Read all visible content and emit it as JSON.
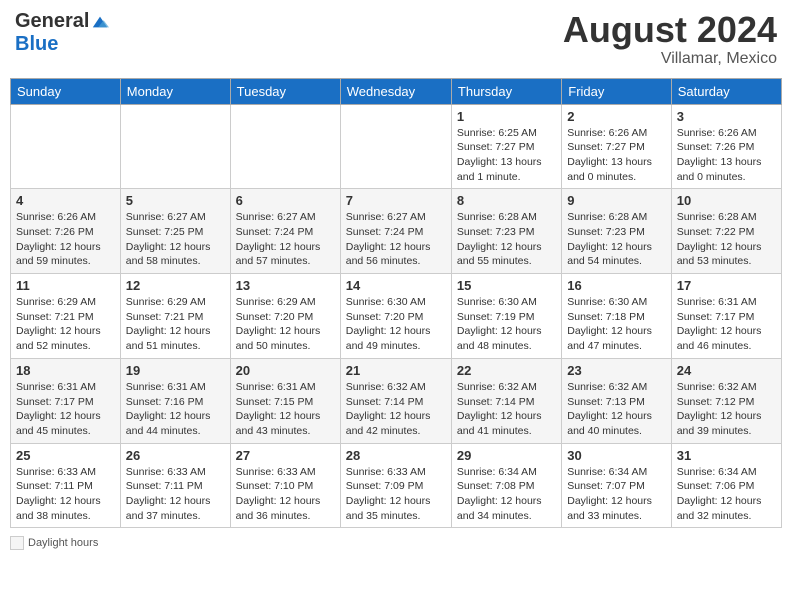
{
  "header": {
    "logo_general": "General",
    "logo_blue": "Blue",
    "month_title": "August 2024",
    "location": "Villamar, Mexico"
  },
  "days_of_week": [
    "Sunday",
    "Monday",
    "Tuesday",
    "Wednesday",
    "Thursday",
    "Friday",
    "Saturday"
  ],
  "weeks": [
    [
      {
        "day": "",
        "info": ""
      },
      {
        "day": "",
        "info": ""
      },
      {
        "day": "",
        "info": ""
      },
      {
        "day": "",
        "info": ""
      },
      {
        "day": "1",
        "info": "Sunrise: 6:25 AM\nSunset: 7:27 PM\nDaylight: 13 hours\nand 1 minute."
      },
      {
        "day": "2",
        "info": "Sunrise: 6:26 AM\nSunset: 7:27 PM\nDaylight: 13 hours\nand 0 minutes."
      },
      {
        "day": "3",
        "info": "Sunrise: 6:26 AM\nSunset: 7:26 PM\nDaylight: 13 hours\nand 0 minutes."
      }
    ],
    [
      {
        "day": "4",
        "info": "Sunrise: 6:26 AM\nSunset: 7:26 PM\nDaylight: 12 hours\nand 59 minutes."
      },
      {
        "day": "5",
        "info": "Sunrise: 6:27 AM\nSunset: 7:25 PM\nDaylight: 12 hours\nand 58 minutes."
      },
      {
        "day": "6",
        "info": "Sunrise: 6:27 AM\nSunset: 7:24 PM\nDaylight: 12 hours\nand 57 minutes."
      },
      {
        "day": "7",
        "info": "Sunrise: 6:27 AM\nSunset: 7:24 PM\nDaylight: 12 hours\nand 56 minutes."
      },
      {
        "day": "8",
        "info": "Sunrise: 6:28 AM\nSunset: 7:23 PM\nDaylight: 12 hours\nand 55 minutes."
      },
      {
        "day": "9",
        "info": "Sunrise: 6:28 AM\nSunset: 7:23 PM\nDaylight: 12 hours\nand 54 minutes."
      },
      {
        "day": "10",
        "info": "Sunrise: 6:28 AM\nSunset: 7:22 PM\nDaylight: 12 hours\nand 53 minutes."
      }
    ],
    [
      {
        "day": "11",
        "info": "Sunrise: 6:29 AM\nSunset: 7:21 PM\nDaylight: 12 hours\nand 52 minutes."
      },
      {
        "day": "12",
        "info": "Sunrise: 6:29 AM\nSunset: 7:21 PM\nDaylight: 12 hours\nand 51 minutes."
      },
      {
        "day": "13",
        "info": "Sunrise: 6:29 AM\nSunset: 7:20 PM\nDaylight: 12 hours\nand 50 minutes."
      },
      {
        "day": "14",
        "info": "Sunrise: 6:30 AM\nSunset: 7:20 PM\nDaylight: 12 hours\nand 49 minutes."
      },
      {
        "day": "15",
        "info": "Sunrise: 6:30 AM\nSunset: 7:19 PM\nDaylight: 12 hours\nand 48 minutes."
      },
      {
        "day": "16",
        "info": "Sunrise: 6:30 AM\nSunset: 7:18 PM\nDaylight: 12 hours\nand 47 minutes."
      },
      {
        "day": "17",
        "info": "Sunrise: 6:31 AM\nSunset: 7:17 PM\nDaylight: 12 hours\nand 46 minutes."
      }
    ],
    [
      {
        "day": "18",
        "info": "Sunrise: 6:31 AM\nSunset: 7:17 PM\nDaylight: 12 hours\nand 45 minutes."
      },
      {
        "day": "19",
        "info": "Sunrise: 6:31 AM\nSunset: 7:16 PM\nDaylight: 12 hours\nand 44 minutes."
      },
      {
        "day": "20",
        "info": "Sunrise: 6:31 AM\nSunset: 7:15 PM\nDaylight: 12 hours\nand 43 minutes."
      },
      {
        "day": "21",
        "info": "Sunrise: 6:32 AM\nSunset: 7:14 PM\nDaylight: 12 hours\nand 42 minutes."
      },
      {
        "day": "22",
        "info": "Sunrise: 6:32 AM\nSunset: 7:14 PM\nDaylight: 12 hours\nand 41 minutes."
      },
      {
        "day": "23",
        "info": "Sunrise: 6:32 AM\nSunset: 7:13 PM\nDaylight: 12 hours\nand 40 minutes."
      },
      {
        "day": "24",
        "info": "Sunrise: 6:32 AM\nSunset: 7:12 PM\nDaylight: 12 hours\nand 39 minutes."
      }
    ],
    [
      {
        "day": "25",
        "info": "Sunrise: 6:33 AM\nSunset: 7:11 PM\nDaylight: 12 hours\nand 38 minutes."
      },
      {
        "day": "26",
        "info": "Sunrise: 6:33 AM\nSunset: 7:11 PM\nDaylight: 12 hours\nand 37 minutes."
      },
      {
        "day": "27",
        "info": "Sunrise: 6:33 AM\nSunset: 7:10 PM\nDaylight: 12 hours\nand 36 minutes."
      },
      {
        "day": "28",
        "info": "Sunrise: 6:33 AM\nSunset: 7:09 PM\nDaylight: 12 hours\nand 35 minutes."
      },
      {
        "day": "29",
        "info": "Sunrise: 6:34 AM\nSunset: 7:08 PM\nDaylight: 12 hours\nand 34 minutes."
      },
      {
        "day": "30",
        "info": "Sunrise: 6:34 AM\nSunset: 7:07 PM\nDaylight: 12 hours\nand 33 minutes."
      },
      {
        "day": "31",
        "info": "Sunrise: 6:34 AM\nSunset: 7:06 PM\nDaylight: 12 hours\nand 32 minutes."
      }
    ]
  ],
  "footer": {
    "legend_label": "Daylight hours"
  }
}
